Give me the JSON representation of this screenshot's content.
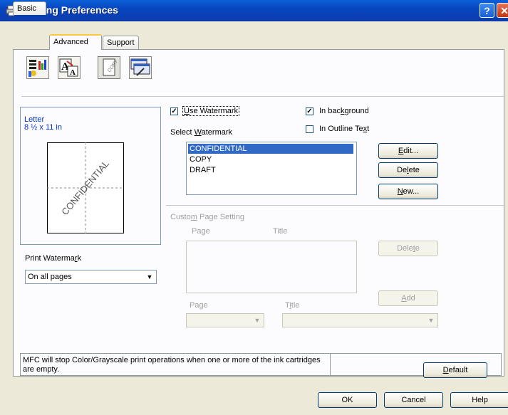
{
  "window": {
    "title": "Printing Preferences",
    "help_label": "?",
    "close_label": "✕"
  },
  "tabs": [
    {
      "label": "Basic"
    },
    {
      "label": "Advanced"
    },
    {
      "label": "Support"
    }
  ],
  "icons": [
    "color-settings-icon",
    "scaling-icon",
    "watermark-icon",
    "device-options-icon"
  ],
  "preview": {
    "paper_name": "Letter",
    "paper_size": "8 ½ x 11 in",
    "watermark_text": "CONFIDENTIAL"
  },
  "watermark": {
    "use_label_pre": "",
    "use_label_u": "U",
    "use_label_post": "se Watermark",
    "use_checked": true,
    "background_pre": "In bac",
    "background_u": "k",
    "background_post": "ground",
    "background_checked": true,
    "outline_pre": "In Outline Te",
    "outline_u": "x",
    "outline_post": "t",
    "outline_checked": false,
    "select_pre": "Select ",
    "select_u": "W",
    "select_post": "atermark",
    "items": [
      "CONFIDENTIAL",
      "COPY",
      "DRAFT"
    ],
    "selected_index": 0,
    "edit_pre": "",
    "edit_u": "E",
    "edit_post": "dit...",
    "delete_pre": "De",
    "delete_u": "l",
    "delete_post": "ete",
    "new_pre": "",
    "new_u": "N",
    "new_post": "ew..."
  },
  "print_watermark": {
    "label_pre": "Print Waterma",
    "label_u": "r",
    "label_post": "k",
    "value": "On all pages"
  },
  "custom": {
    "title_pre": "Custo",
    "title_u": "m",
    "title_post": " Page Setting",
    "col_page": "Page",
    "col_title": "Title",
    "delete_pre": "Dele",
    "delete_u": "t",
    "delete_post": "e",
    "add_pre": "",
    "add_u": "A",
    "add_post": "dd",
    "page_label": "Page",
    "title_label_pre": "T",
    "title_label_u": "i",
    "title_label_post": "tle"
  },
  "footer": {
    "message": "MFC will stop Color/Grayscale print operations when one or more of the ink cartridges are empty.",
    "default_pre": "",
    "default_u": "D",
    "default_post": "efault",
    "ok": "OK",
    "cancel": "Cancel",
    "help": "Help"
  }
}
